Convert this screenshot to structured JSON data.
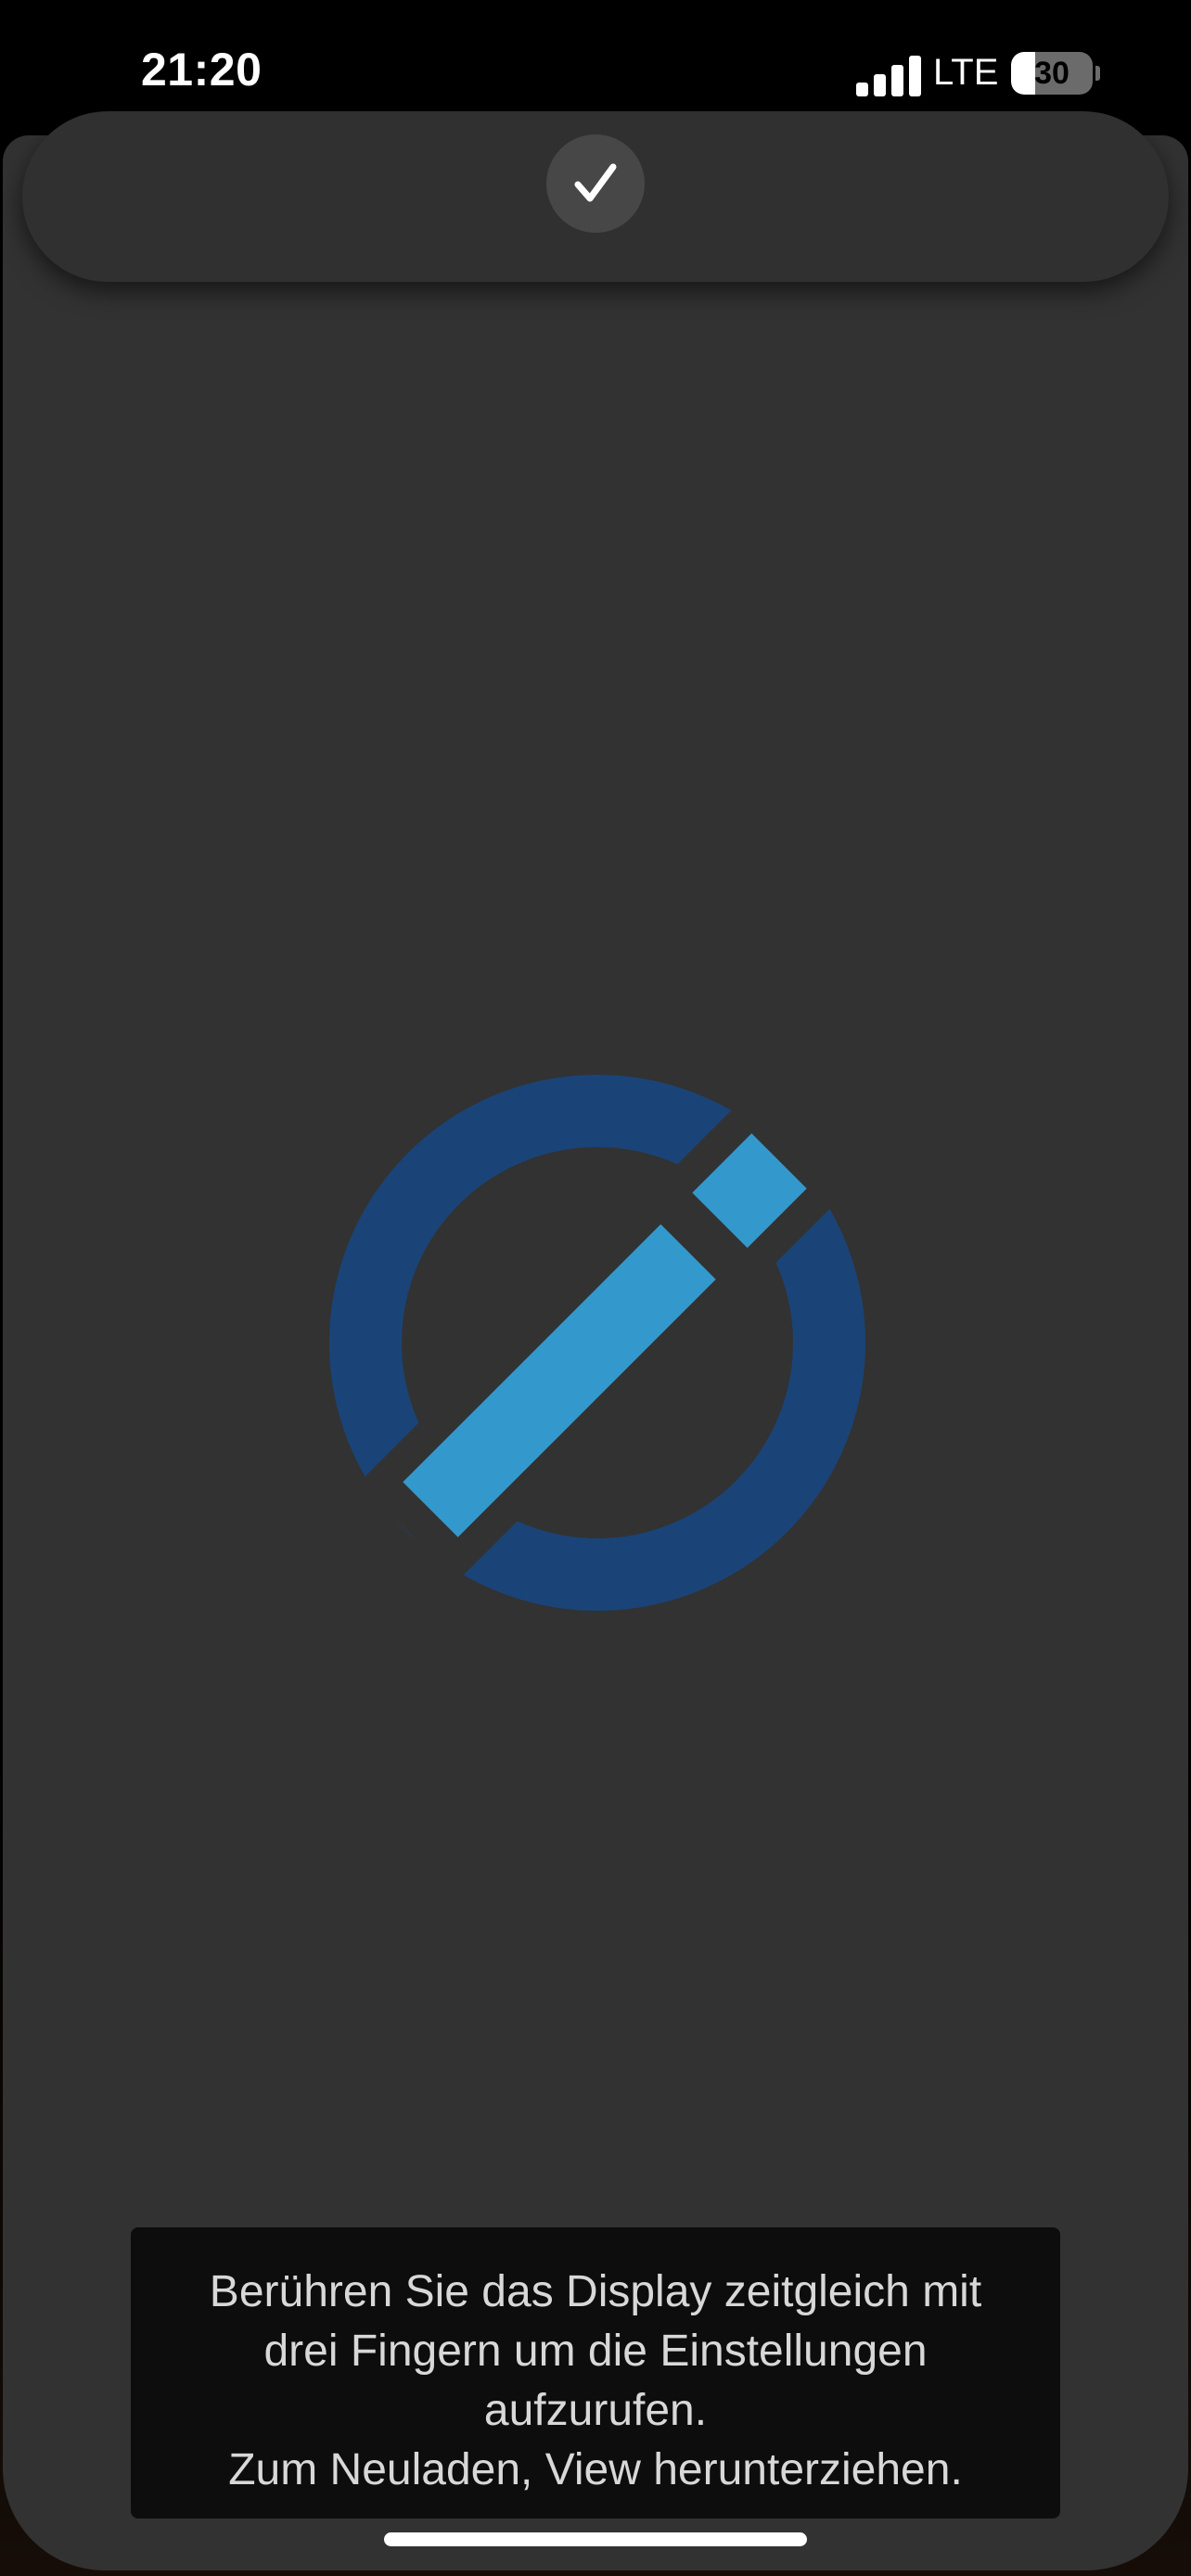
{
  "status_bar": {
    "time": "21:20",
    "carrier": "LTE",
    "battery_level": "30",
    "battery_fraction": 0.3,
    "signal_bars": 4
  },
  "top_bar": {
    "confirm_icon": "checkmark-icon"
  },
  "logo": {
    "icon": "pen-in-circle-logo-icon",
    "ring_color": "#1a4478",
    "pen_color": "#3399cc"
  },
  "hint": {
    "lines": [
      "Berühren Sie das Display zeitgleich mit",
      "drei Fingern um die Einstellungen",
      "aufzurufen.",
      "Zum Neuladen, View herunterziehen."
    ]
  },
  "colors": {
    "app_background": "#323232",
    "hint_background": "#0d0d0d",
    "hint_text": "#d8d8d8"
  }
}
